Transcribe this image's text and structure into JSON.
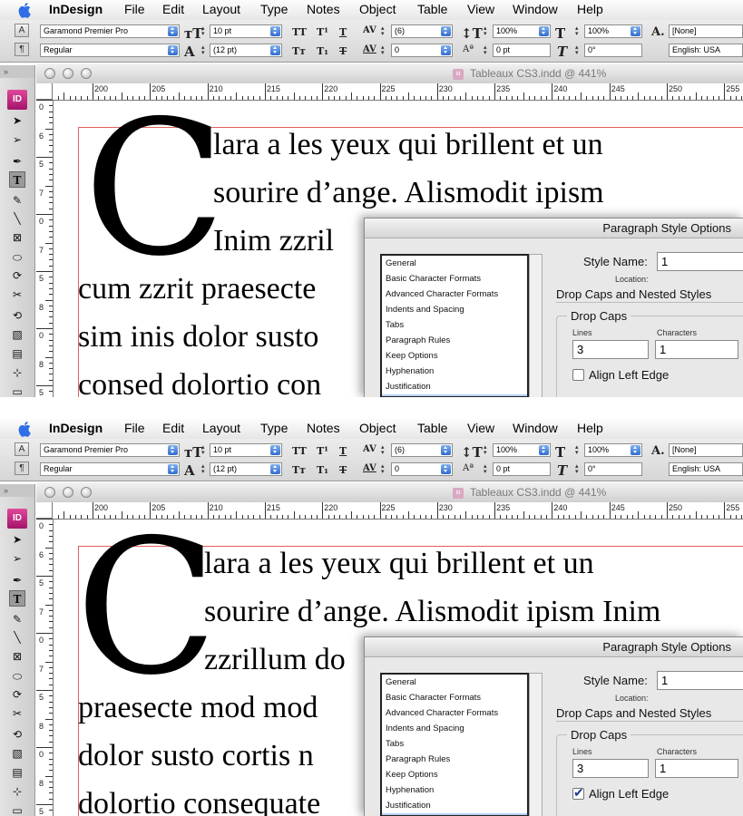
{
  "menubar": {
    "app": "InDesign",
    "items": [
      "File",
      "Edit",
      "Layout",
      "Type",
      "Notes",
      "Object",
      "Table",
      "View",
      "Window",
      "Help"
    ]
  },
  "control": {
    "font_family": "Garamond Premier Pro",
    "font_style": "Regular",
    "font_size": "10 pt",
    "leading": "(12 pt)",
    "kerning": "(6)",
    "tracking": "0",
    "vertical_scale": "100%",
    "horizontal_scale": "100%",
    "baseline_shift": "0 pt",
    "skew": "0°",
    "char_style": "[None]",
    "language": "English: USA",
    "mode_char": "A",
    "mode_para": "¶"
  },
  "toolbox": {
    "logo": "ID"
  },
  "document": {
    "title": "Tableaux CS3.indd @ 441%",
    "ruler_labels": [
      "200",
      "205",
      "210",
      "215",
      "220",
      "225",
      "230",
      "235",
      "240",
      "245",
      "250",
      "255"
    ],
    "vruler_labels": [
      "0",
      "6",
      "5",
      "7",
      "0",
      "7",
      "5",
      "8",
      "0",
      "8",
      "5"
    ]
  },
  "dialog": {
    "title": "Paragraph Style Options",
    "categories": [
      "General",
      "Basic Character Formats",
      "Advanced Character Formats",
      "Indents and Spacing",
      "Tabs",
      "Paragraph Rules",
      "Keep Options",
      "Hyphenation",
      "Justification"
    ],
    "style_name_label": "Style Name:",
    "style_name_value": "1",
    "location_label": "Location:",
    "section_heading": "Drop Caps and Nested Styles",
    "drop_caps_label": "Drop Caps",
    "lines_label": "Lines",
    "characters_label": "Characters",
    "lines_value": "3",
    "characters_value": "1",
    "align_left_edge_label": "Align Left Edge"
  },
  "panel_top": {
    "drop_cap": "C",
    "lines": [
      "lara a les yeux qui brillent et un",
      "sourire d’ange. Alismodit ipism",
      "Inim zzril",
      "cum zzrit praesecte",
      "sim inis dolor susto",
      "consed dolortio con"
    ],
    "align_left_edge_checked": false
  },
  "panel_bottom": {
    "drop_cap": "C",
    "lines": [
      "lara a les yeux qui brillent et un",
      "sourire d’ange. Alismodit ipism Inim",
      "zzrillum do",
      "praesecte mod mod",
      "dolor susto cortis n",
      "dolortio consequate"
    ],
    "align_left_edge_checked": true
  }
}
